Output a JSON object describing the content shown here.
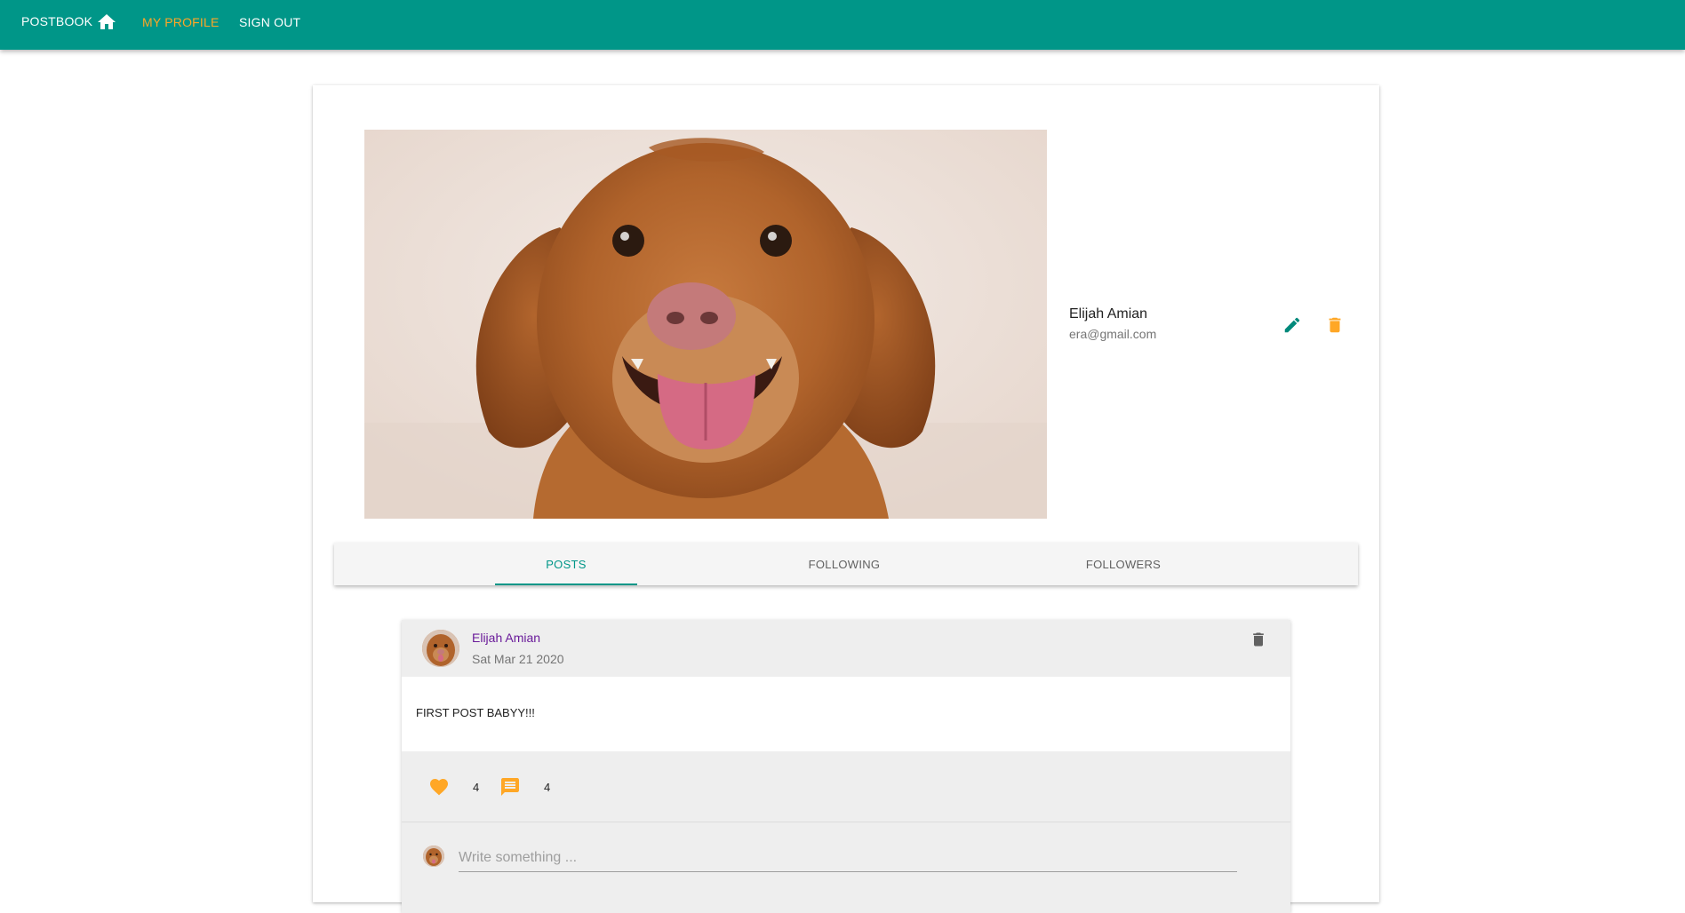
{
  "nav": {
    "brand": "POSTBOOK",
    "home_icon": "home-icon",
    "links": [
      {
        "label": "MY PROFILE",
        "active": true
      },
      {
        "label": "SIGN OUT",
        "active": false
      }
    ],
    "bar_color": "#009688",
    "active_color": "#ffa726"
  },
  "profile": {
    "photo_subject": "golden-brown dog",
    "name": "Elijah Amian",
    "email": "era@gmail.com",
    "edit_icon": "pencil-icon",
    "delete_icon": "trash-icon"
  },
  "tabs": [
    {
      "label": "POSTS",
      "active": true
    },
    {
      "label": "FOLLOWING",
      "active": false
    },
    {
      "label": "FOLLOWERS",
      "active": false
    }
  ],
  "post": {
    "author": "Elijah Amian",
    "date": "Sat Mar 21 2020",
    "text": "FIRST POST BABYY!!!",
    "likes": "4",
    "comments": "4",
    "like_icon": "heart-icon",
    "comment_icon": "comment-icon",
    "delete_icon": "trash-icon"
  },
  "compose": {
    "placeholder": "Write something ..."
  }
}
